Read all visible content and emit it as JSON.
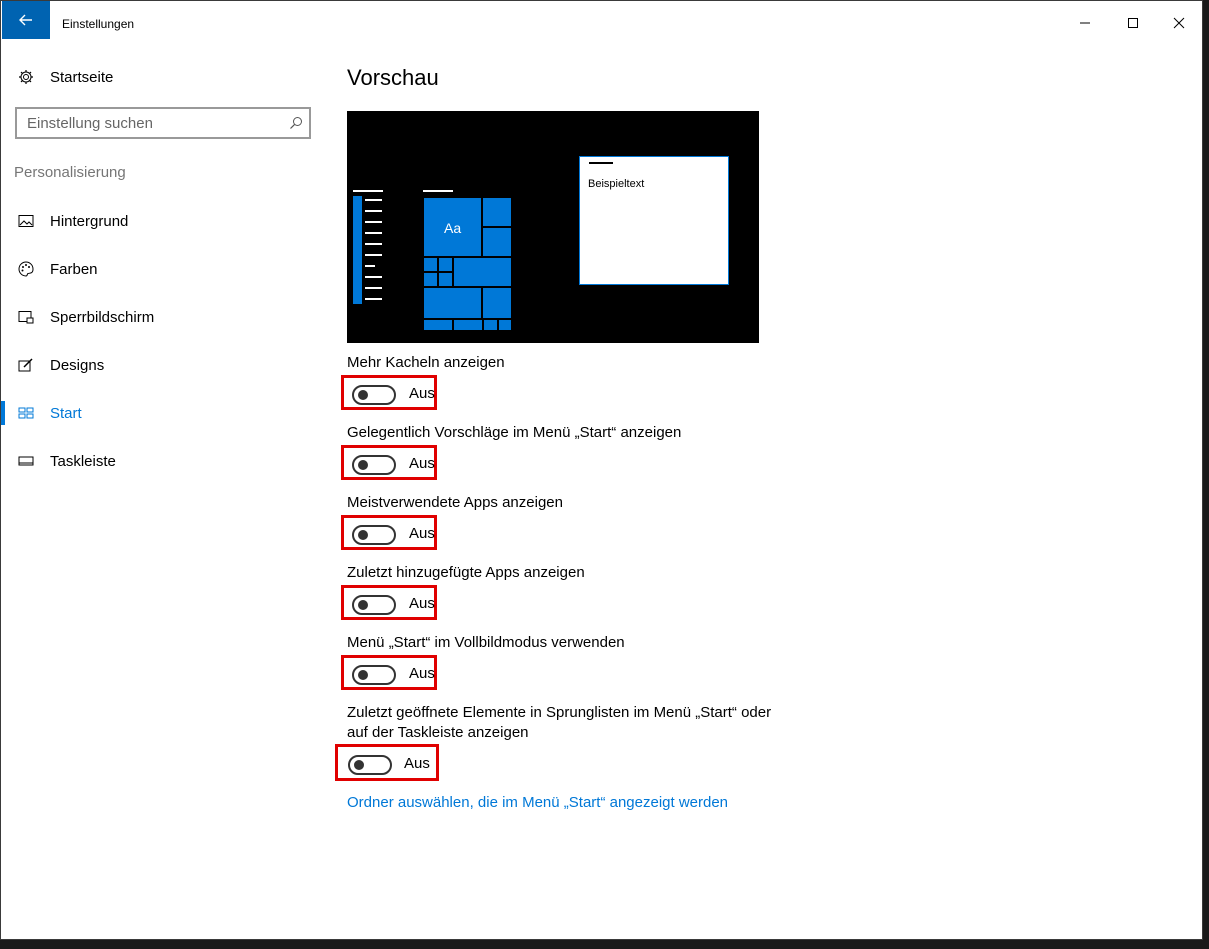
{
  "window": {
    "title": "Einstellungen"
  },
  "sidebar": {
    "home": "Startseite",
    "search_placeholder": "Einstellung suchen",
    "section": "Personalisierung",
    "items": [
      {
        "label": "Hintergrund",
        "icon": "picture-icon"
      },
      {
        "label": "Farben",
        "icon": "palette-icon"
      },
      {
        "label": "Sperrbildschirm",
        "icon": "lock-screen-icon"
      },
      {
        "label": "Designs",
        "icon": "brush-icon"
      },
      {
        "label": "Start",
        "icon": "start-icon",
        "active": true
      },
      {
        "label": "Taskleiste",
        "icon": "taskbar-icon"
      }
    ]
  },
  "main": {
    "title": "Vorschau",
    "preview": {
      "tile_text": "Aa",
      "sample_text": "Beispieltext"
    },
    "settings": [
      {
        "label": "Mehr Kacheln anzeigen",
        "state": "Aus"
      },
      {
        "label": "Gelegentlich Vorschläge im Menü „Start“ anzeigen",
        "state": "Aus"
      },
      {
        "label": "Meistverwendete Apps anzeigen",
        "state": "Aus"
      },
      {
        "label": "Zuletzt hinzugefügte Apps anzeigen",
        "state": "Aus"
      },
      {
        "label": "Menü „Start“ im Vollbildmodus verwenden",
        "state": "Aus"
      },
      {
        "label_line1": "Zuletzt geöffnete Elemente in Sprunglisten im Menü „Start“ oder",
        "label_line2": "auf der Taskleiste anzeigen",
        "state": "Aus"
      }
    ],
    "link": "Ordner auswählen, die im Menü „Start“ angezeigt werden"
  },
  "colors": {
    "accent": "#0078d7",
    "highlight_border": "#e00000"
  }
}
